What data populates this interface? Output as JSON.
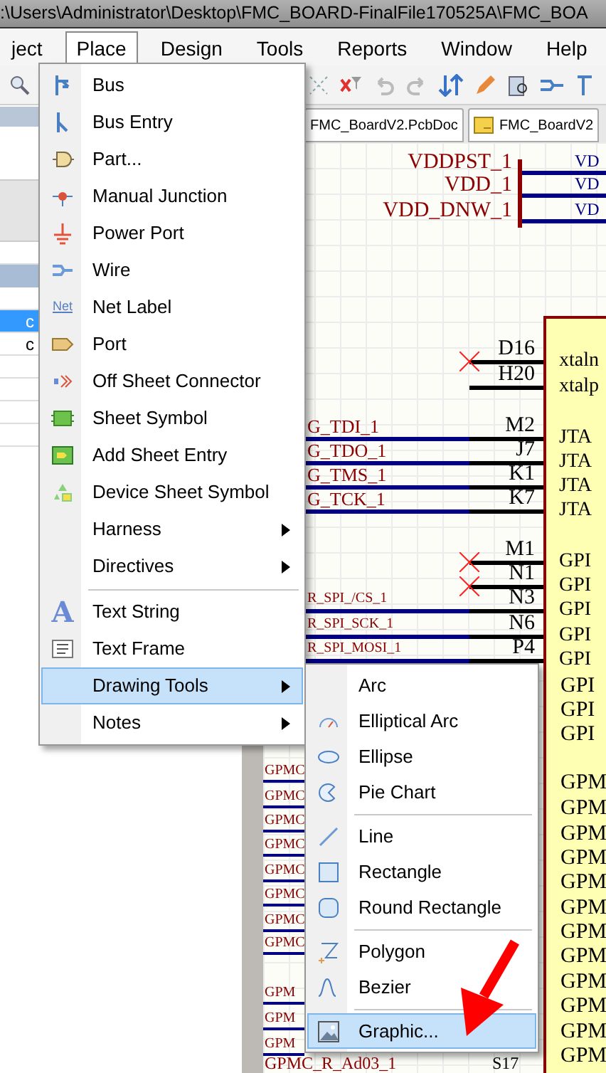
{
  "title_bar": {
    "title": ":\\Users\\Administrator\\Desktop\\FMC_BOARD-FinalFile170525A\\FMC_BOA"
  },
  "menu_bar": [
    {
      "label": "ject",
      "selected": false
    },
    {
      "label": "Place",
      "selected": true
    },
    {
      "label": "Design",
      "selected": false
    },
    {
      "label": "Tools",
      "selected": false
    },
    {
      "label": "Reports",
      "selected": false
    },
    {
      "label": "Window",
      "selected": false
    },
    {
      "label": "Help",
      "selected": false
    }
  ],
  "panel_rows": [
    {
      "label": "c",
      "selected": true
    },
    {
      "label": "c",
      "selected": false
    }
  ],
  "doc_tabs": [
    {
      "label": "FMC_BoardV2.PcbDoc"
    },
    {
      "label": "FMC_BoardV2"
    }
  ],
  "schematic": {
    "power_nets": [
      "VDDPST_1",
      "VDD_1",
      "VDD_DNW_1"
    ],
    "power_right": [
      "VD",
      "VD",
      "VD"
    ],
    "pins": [
      {
        "number": "D16",
        "inner": "xtaln",
        "unconnected": true
      },
      {
        "number": "H20",
        "inner": "xtalp",
        "unconnected": false
      },
      {
        "number": "M2",
        "net": "G_TDI_1",
        "inner": "JTA",
        "unconnected": false
      },
      {
        "number": "J7",
        "net": "G_TDO_1",
        "inner": "JTA",
        "unconnected": false
      },
      {
        "number": "K1",
        "net": "G_TMS_1",
        "inner": "JTA",
        "unconnected": false
      },
      {
        "number": "K7",
        "net": "G_TCK_1",
        "inner": "JTA",
        "unconnected": false
      },
      {
        "number": "M1",
        "inner": "GPI",
        "unconnected": true
      },
      {
        "number": "N1",
        "inner": "GPI",
        "unconnected": true
      },
      {
        "number": "N3",
        "net": "R_SPI_/CS_1",
        "inner": "GPI",
        "unconnected": false
      },
      {
        "number": "N6",
        "net": "R_SPI_SCK_1",
        "inner": "GPI",
        "unconnected": false
      },
      {
        "number": "P4",
        "net": "R_SPI_MOSI_1",
        "inner": "GPI",
        "unconnected": false
      }
    ],
    "body_labels": [
      "GPI",
      "GPI",
      "GPI",
      "GPM",
      "GPM",
      "GPM",
      "GPM",
      "GPM",
      "GPM",
      "GPM",
      "GPM",
      "GPM",
      "GPM",
      "GPM",
      "GPM"
    ],
    "left_labels": [
      "GPMC",
      "GPMC",
      "GPMC",
      "GPMC",
      "GPMC",
      "GPMC",
      "GPMC",
      "GPMC",
      "GPM",
      "GPM",
      "GPM"
    ],
    "bottom_net": "GPMC_R_Ad03_1",
    "bottom_pin": "S17"
  },
  "place_menu": [
    {
      "label": "Bus",
      "kind": "item",
      "selected": false
    },
    {
      "label": "Bus Entry",
      "kind": "item",
      "selected": false
    },
    {
      "label": "Part...",
      "kind": "item",
      "selected": false
    },
    {
      "label": "Manual Junction",
      "kind": "item",
      "selected": false
    },
    {
      "label": "Power Port",
      "kind": "item",
      "selected": false
    },
    {
      "label": "Wire",
      "kind": "item",
      "selected": false
    },
    {
      "label": "Net Label",
      "kind": "item",
      "selected": false,
      "glyph": "Net"
    },
    {
      "label": "Port",
      "kind": "item",
      "selected": false
    },
    {
      "label": "Off Sheet Connector",
      "kind": "item",
      "selected": false
    },
    {
      "label": "Sheet Symbol",
      "kind": "item",
      "selected": false
    },
    {
      "label": "Add Sheet Entry",
      "kind": "item",
      "selected": false
    },
    {
      "label": "Device Sheet Symbol",
      "kind": "item",
      "selected": false
    },
    {
      "label": "Harness",
      "kind": "submenu",
      "selected": false
    },
    {
      "label": "Directives",
      "kind": "submenu",
      "selected": false
    },
    {
      "kind": "separator"
    },
    {
      "label": "Text String",
      "kind": "item",
      "selected": false,
      "glyph": "A"
    },
    {
      "label": "Text Frame",
      "kind": "item",
      "selected": false
    },
    {
      "label": "Drawing Tools",
      "kind": "submenu",
      "selected": true
    },
    {
      "label": "Notes",
      "kind": "submenu",
      "selected": false
    }
  ],
  "drawing_tools_menu": [
    {
      "label": "Arc",
      "kind": "item",
      "selected": false
    },
    {
      "label": "Elliptical Arc",
      "kind": "item",
      "selected": false
    },
    {
      "label": "Ellipse",
      "kind": "item",
      "selected": false
    },
    {
      "label": "Pie Chart",
      "kind": "item",
      "selected": false
    },
    {
      "kind": "separator"
    },
    {
      "label": "Line",
      "kind": "item",
      "selected": false
    },
    {
      "label": "Rectangle",
      "kind": "item",
      "selected": false
    },
    {
      "label": "Round Rectangle",
      "kind": "item",
      "selected": false
    },
    {
      "kind": "separator"
    },
    {
      "label": "Polygon",
      "kind": "item",
      "selected": false
    },
    {
      "label": "Bezier",
      "kind": "item",
      "selected": false
    },
    {
      "kind": "separator"
    },
    {
      "label": "Graphic...",
      "kind": "item",
      "selected": true
    }
  ]
}
